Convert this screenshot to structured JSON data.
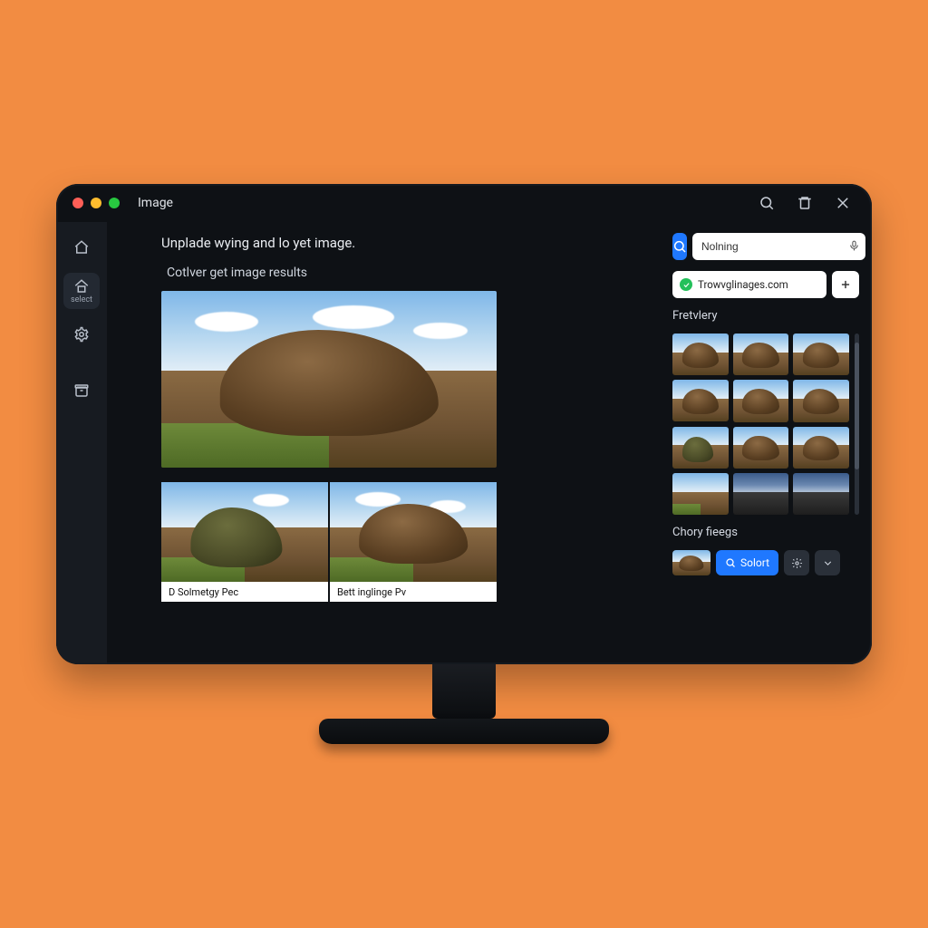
{
  "window": {
    "title": "Image"
  },
  "sidebar": {
    "items": [
      {
        "name": "home",
        "label": ""
      },
      {
        "name": "select",
        "label": "select"
      },
      {
        "name": "settings",
        "label": ""
      },
      {
        "name": "archive",
        "label": ""
      }
    ]
  },
  "main": {
    "headline": "Unplade wying and lo yet image.",
    "subheading": "Cotlver get image results",
    "results": [
      {
        "caption": "D Solmetgy Pec"
      },
      {
        "caption": "Bett inglinge Pv"
      }
    ]
  },
  "panel": {
    "search_value": "Nolning",
    "url": "Trowvglinages.com",
    "section_a": "Fretvlery",
    "section_b": "Chory fieegs",
    "select_label": "Solort"
  }
}
